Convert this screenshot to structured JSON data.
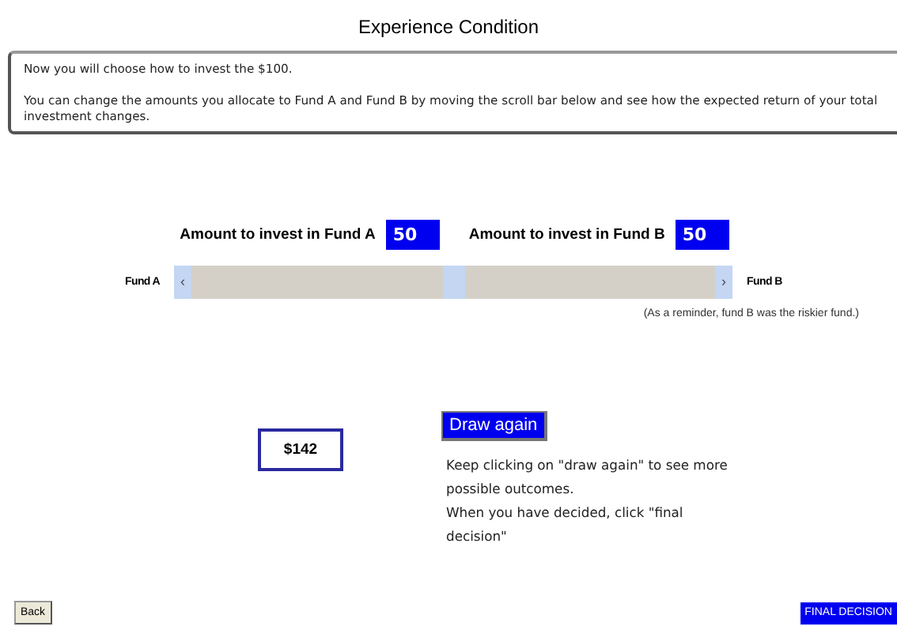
{
  "title": "Experience Condition",
  "instructions": [
    "Now you will choose how to invest the $100.",
    "You can change the amounts you allocate to Fund A and Fund B by moving the scroll bar below and see how the expected return of your total investment changes."
  ],
  "amounts": [
    {
      "label": "Amount to invest in Fund A",
      "value": "50"
    },
    {
      "label": "Amount to invest in Fund B",
      "value": "50"
    }
  ],
  "slider": {
    "left_label": "Fund A",
    "right_label": "Fund B",
    "left_arrow": "‹",
    "right_arrow": "›",
    "level": 0.5
  },
  "reminder": "(As a reminder, fund B was the riskier fund.)",
  "outcome": "$142",
  "draw_button": "Draw again",
  "help": [
    "Keep clicking on \"draw again\" to see more possible outcomes.",
    "When you have decided, click \"final decision\""
  ],
  "back_button": "Back",
  "final_button": "FINAL DECISION"
}
